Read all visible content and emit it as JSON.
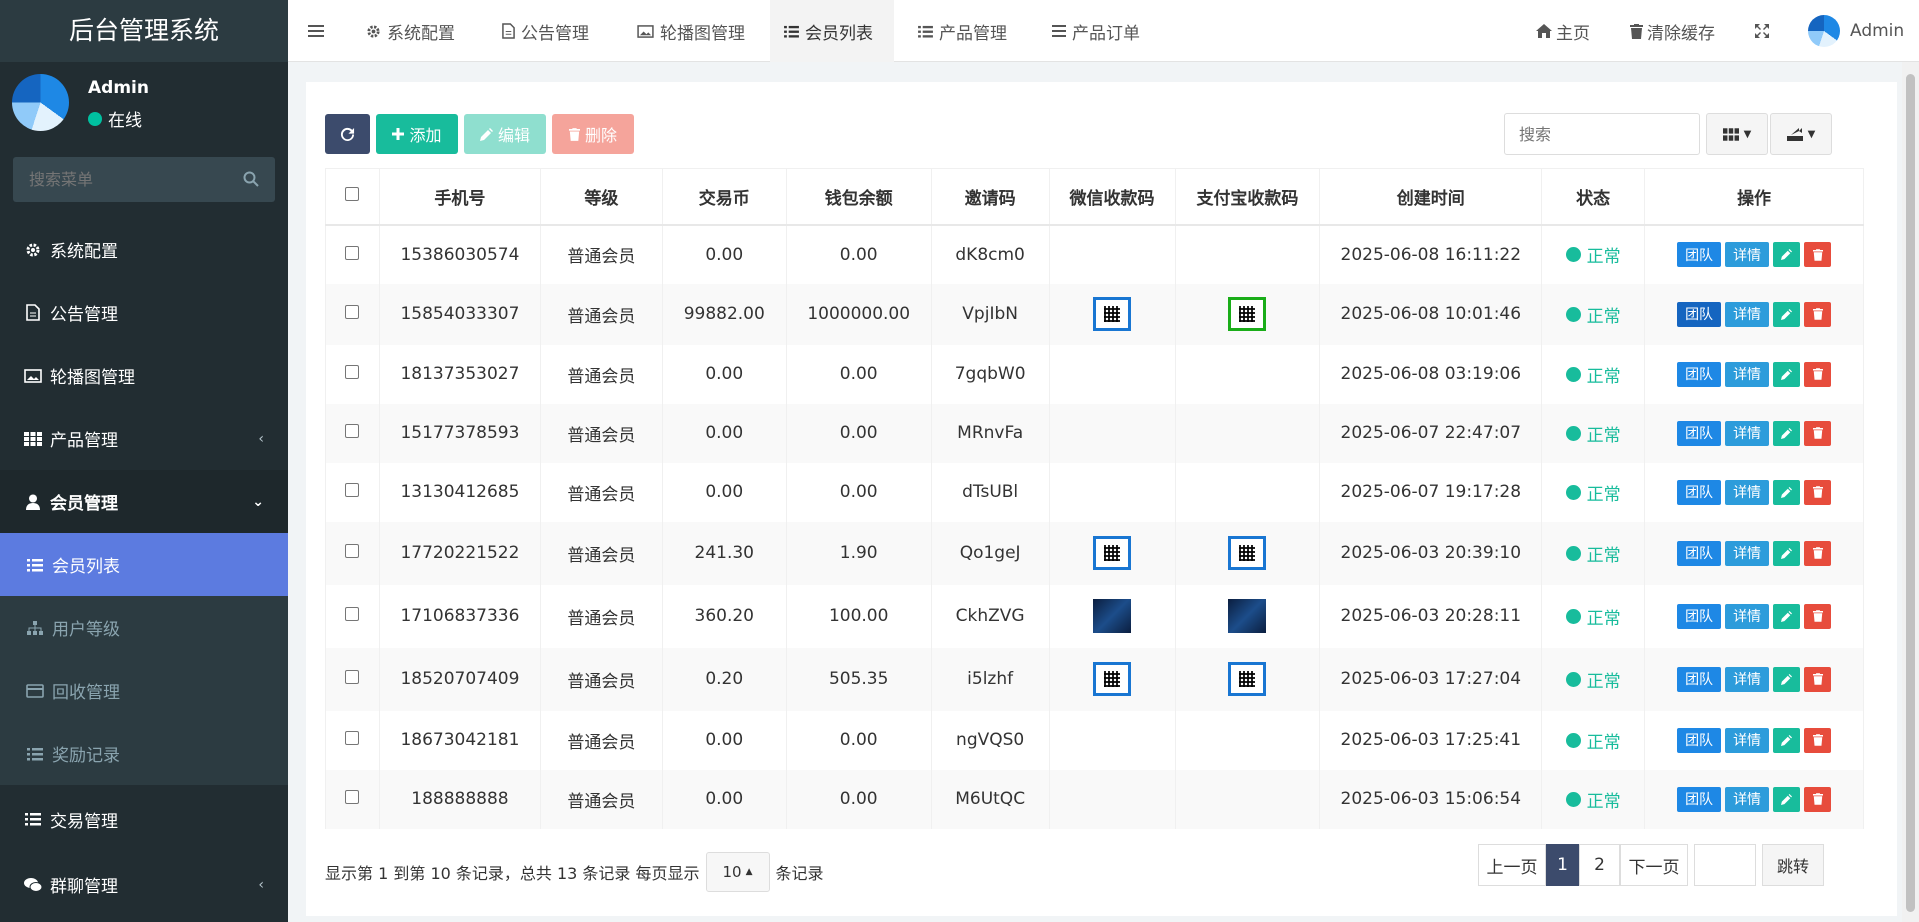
{
  "app": {
    "title": "后台管理系统"
  },
  "user": {
    "name": "Admin",
    "status": "在线"
  },
  "sidebar": {
    "search_placeholder": "搜索菜单",
    "items": [
      {
        "label": "系统配置",
        "icon": "gear-icon"
      },
      {
        "label": "公告管理",
        "icon": "file-icon"
      },
      {
        "label": "轮播图管理",
        "icon": "image-icon"
      },
      {
        "label": "产品管理",
        "icon": "grid-icon"
      },
      {
        "label": "会员管理",
        "icon": "user-icon"
      },
      {
        "label": "交易管理",
        "icon": "list-icon"
      },
      {
        "label": "群聊管理",
        "icon": "chat-icon"
      }
    ],
    "subitems": [
      {
        "label": "会员列表",
        "icon": "list-icon"
      },
      {
        "label": "用户等级",
        "icon": "sitemap-icon"
      },
      {
        "label": "回收管理",
        "icon": "card-icon"
      },
      {
        "label": "奖励记录",
        "icon": "list-icon"
      }
    ]
  },
  "topbar": {
    "tabs": [
      {
        "label": "系统配置",
        "icon": "gear-icon"
      },
      {
        "label": "公告管理",
        "icon": "file-icon"
      },
      {
        "label": "轮播图管理",
        "icon": "image-icon"
      },
      {
        "label": "会员列表",
        "icon": "list-icon"
      },
      {
        "label": "产品管理",
        "icon": "list-icon"
      },
      {
        "label": "产品订单",
        "icon": "bars-icon"
      }
    ],
    "home": "主页",
    "clear_cache": "清除缓存",
    "admin": "Admin"
  },
  "toolbar": {
    "add": "添加",
    "edit": "编辑",
    "delete": "删除",
    "search_placeholder": "搜索"
  },
  "table": {
    "headers": [
      "手机号",
      "等级",
      "交易币",
      "钱包余额",
      "邀请码",
      "微信收款码",
      "支付宝收款码",
      "创建时间",
      "状态",
      "操作"
    ],
    "rows": [
      {
        "phone": "15386030574",
        "level": "普通会员",
        "coin": "0.00",
        "balance": "0.00",
        "code": "dK8cm0",
        "wechat": "",
        "alipay": "",
        "created": "2025-06-08 16:11:22",
        "status": "正常"
      },
      {
        "phone": "15854033307",
        "level": "普通会员",
        "coin": "99882.00",
        "balance": "1000000.00",
        "code": "VpjIbN",
        "wechat": "qr",
        "alipay": "qr-green",
        "created": "2025-06-08 10:01:46",
        "status": "正常"
      },
      {
        "phone": "18137353027",
        "level": "普通会员",
        "coin": "0.00",
        "balance": "0.00",
        "code": "7gqbW0",
        "wechat": "",
        "alipay": "",
        "created": "2025-06-08 03:19:06",
        "status": "正常"
      },
      {
        "phone": "15177378593",
        "level": "普通会员",
        "coin": "0.00",
        "balance": "0.00",
        "code": "MRnvFa",
        "wechat": "",
        "alipay": "",
        "created": "2025-06-07 22:47:07",
        "status": "正常"
      },
      {
        "phone": "13130412685",
        "level": "普通会员",
        "coin": "0.00",
        "balance": "0.00",
        "code": "dTsUBl",
        "wechat": "",
        "alipay": "",
        "created": "2025-06-07 19:17:28",
        "status": "正常"
      },
      {
        "phone": "17720221522",
        "level": "普通会员",
        "coin": "241.30",
        "balance": "1.90",
        "code": "Qo1geJ",
        "wechat": "qr",
        "alipay": "qr",
        "created": "2025-06-03 20:39:10",
        "status": "正常"
      },
      {
        "phone": "17106837336",
        "level": "普通会员",
        "coin": "360.20",
        "balance": "100.00",
        "code": "CkhZVG",
        "wechat": "qr-dark",
        "alipay": "qr-dark",
        "created": "2025-06-03 20:28:11",
        "status": "正常"
      },
      {
        "phone": "18520707409",
        "level": "普通会员",
        "coin": "0.20",
        "balance": "505.35",
        "code": "i5lzhf",
        "wechat": "qr",
        "alipay": "qr",
        "created": "2025-06-03 17:27:04",
        "status": "正常"
      },
      {
        "phone": "18673042181",
        "level": "普通会员",
        "coin": "0.00",
        "balance": "0.00",
        "code": "ngVQS0",
        "wechat": "",
        "alipay": "",
        "created": "2025-06-03 17:25:41",
        "status": "正常"
      },
      {
        "phone": "188888888",
        "level": "普通会员",
        "coin": "0.00",
        "balance": "0.00",
        "code": "M6UtQC",
        "wechat": "",
        "alipay": "",
        "created": "2025-06-03 15:06:54",
        "status": "正常"
      }
    ],
    "action_team": "团队",
    "action_detail": "详情"
  },
  "pagination": {
    "info_prefix": "显示第 1 到第 10 条记录，总共 13 条记录 每页显示",
    "page_size": "10",
    "info_suffix": "条记录",
    "prev": "上一页",
    "pages": [
      "1",
      "2"
    ],
    "current": "1",
    "next": "下一页",
    "jump": "跳转"
  },
  "colors": {
    "sidebar_bg": "#222d32",
    "active_menu": "#5c7be0",
    "primary": "#3c4b6c",
    "success": "#18bc9c",
    "danger": "#e74c3c",
    "info": "#1e88e5"
  }
}
